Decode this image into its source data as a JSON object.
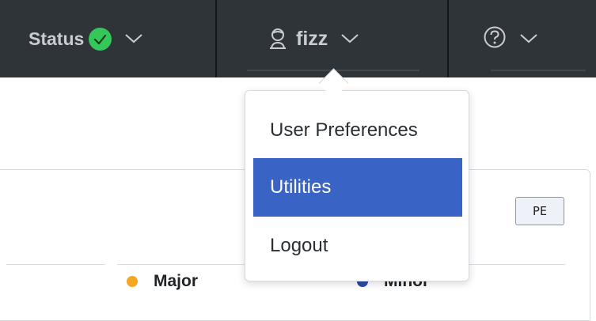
{
  "topbar": {
    "status_label": "Status",
    "user_name": "fizz",
    "help_icon": "question-circle-icon",
    "status_icon": "check-circle-icon",
    "chevron_icon": "chevron-down-icon"
  },
  "user_menu": {
    "items": [
      {
        "label": "User Preferences",
        "active": false
      },
      {
        "label": "Utilities",
        "active": true
      },
      {
        "label": "Logout",
        "active": false
      }
    ]
  },
  "content": {
    "badge": "PE",
    "legend": [
      {
        "label": "Major",
        "color": "#f5a623"
      },
      {
        "label": "Minor",
        "color": "#2d4aa8"
      }
    ]
  },
  "colors": {
    "topbar_bg": "#2f3438",
    "status_ok": "#34c759",
    "menu_active": "#3a63c6"
  }
}
